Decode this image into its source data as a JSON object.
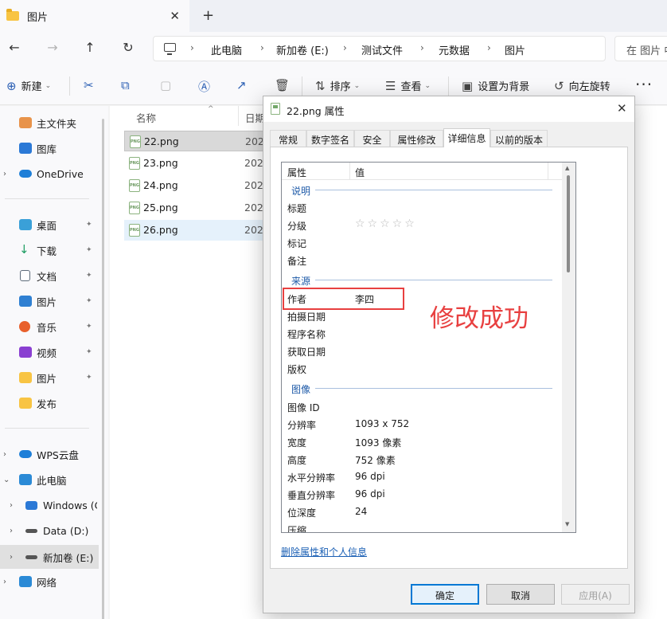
{
  "window": {
    "tab_title": "图片",
    "tab_close": "✕",
    "new_tab": "+"
  },
  "nav": {
    "back": "←",
    "forward": "→",
    "up": "↑",
    "refresh": "↻",
    "breadcrumbs": [
      "此电脑",
      "新加卷 (E:)",
      "测试文件",
      "元数据",
      "图片"
    ],
    "crumb_sep": "›",
    "search_placeholder": "在 图片 中"
  },
  "toolbar": {
    "new_label": "新建",
    "sort_label": "排序",
    "view_label": "查看",
    "set_bg_label": "设置为背景",
    "rotate_left_label": "向左旋转",
    "more": "···"
  },
  "sidebar": {
    "items": [
      {
        "label": "主文件夹",
        "icon": "home-icon",
        "color": "#e8934a"
      },
      {
        "label": "图库",
        "icon": "gallery-icon",
        "color": "#2b79d6"
      },
      {
        "label": "OneDrive",
        "icon": "cloud-icon",
        "color": "#1e7fd8"
      },
      {
        "label": "桌面",
        "icon": "desktop-icon",
        "color": "#3aa0d8"
      },
      {
        "label": "下载",
        "icon": "download-icon",
        "color": "#1e9c62"
      },
      {
        "label": "文档",
        "icon": "document-icon",
        "color": "#5d6b7a"
      },
      {
        "label": "图片",
        "icon": "pictures-icon",
        "color": "#2f80d2"
      },
      {
        "label": "音乐",
        "icon": "music-icon",
        "color": "#e8602c"
      },
      {
        "label": "视频",
        "icon": "video-icon",
        "color": "#8a3fd1"
      },
      {
        "label": "图片",
        "icon": "folder-icon",
        "color": "#f8c443"
      },
      {
        "label": "发布",
        "icon": "folder-icon",
        "color": "#f8c443"
      },
      {
        "label": "WPS云盘",
        "icon": "cloud-icon",
        "color": "#1e7fd8"
      },
      {
        "label": "此电脑",
        "icon": "computer-icon",
        "color": "#2b8ad6"
      },
      {
        "label": "Windows (C",
        "icon": "windows-drive-icon",
        "color": "#2b79d6"
      },
      {
        "label": "Data (D:)",
        "icon": "drive-icon",
        "color": "#555555"
      },
      {
        "label": "新加卷 (E:)",
        "icon": "drive-icon",
        "color": "#555555"
      },
      {
        "label": "网络",
        "icon": "network-icon",
        "color": "#2b8ad6"
      }
    ],
    "pin": "📌",
    "chev_right": "›",
    "chev_down": "⌄"
  },
  "filelist": {
    "col_name": "名称",
    "col_date": "日期",
    "sort_arrow": "^",
    "files": [
      {
        "name": "22.png",
        "date": "202"
      },
      {
        "name": "23.png",
        "date": "202"
      },
      {
        "name": "24.png",
        "date": "202"
      },
      {
        "name": "25.png",
        "date": "202"
      },
      {
        "name": "26.png",
        "date": "202"
      }
    ]
  },
  "dialog": {
    "title": "22.png 属性",
    "close": "✕",
    "tabs": [
      "常规",
      "数字签名",
      "安全",
      "属性修改",
      "详细信息",
      "以前的版本"
    ],
    "col_property": "属性",
    "col_value": "值",
    "groups": {
      "description": "说明",
      "origin": "来源",
      "image": "图像"
    },
    "rows": {
      "title": {
        "name": "标题",
        "value": ""
      },
      "rating": {
        "name": "分级",
        "value": "☆☆☆☆☆"
      },
      "tags": {
        "name": "标记",
        "value": ""
      },
      "comments": {
        "name": "备注",
        "value": ""
      },
      "author": {
        "name": "作者",
        "value": "李四"
      },
      "date_taken": {
        "name": "拍摄日期",
        "value": ""
      },
      "program": {
        "name": "程序名称",
        "value": ""
      },
      "date_acquired": {
        "name": "获取日期",
        "value": ""
      },
      "copyright": {
        "name": "版权",
        "value": ""
      },
      "image_id": {
        "name": "图像 ID",
        "value": ""
      },
      "dimensions": {
        "name": "分辨率",
        "value": "1093 x 752"
      },
      "width": {
        "name": "宽度",
        "value": "1093 像素"
      },
      "height": {
        "name": "高度",
        "value": "752 像素"
      },
      "h_res": {
        "name": "水平分辨率",
        "value": "96 dpi"
      },
      "v_res": {
        "name": "垂直分辨率",
        "value": "96 dpi"
      },
      "bit_depth": {
        "name": "位深度",
        "value": "24"
      },
      "compression": {
        "name": "压缩",
        "value": ""
      }
    },
    "annotation": "修改成功",
    "remove_link": "删除属性和个人信息",
    "ok": "确定",
    "cancel": "取消",
    "apply": "应用(A)"
  },
  "colors": {
    "accent": "#0078d4",
    "annotation_red": "#e84040",
    "group_blue": "#1e5aa8"
  }
}
